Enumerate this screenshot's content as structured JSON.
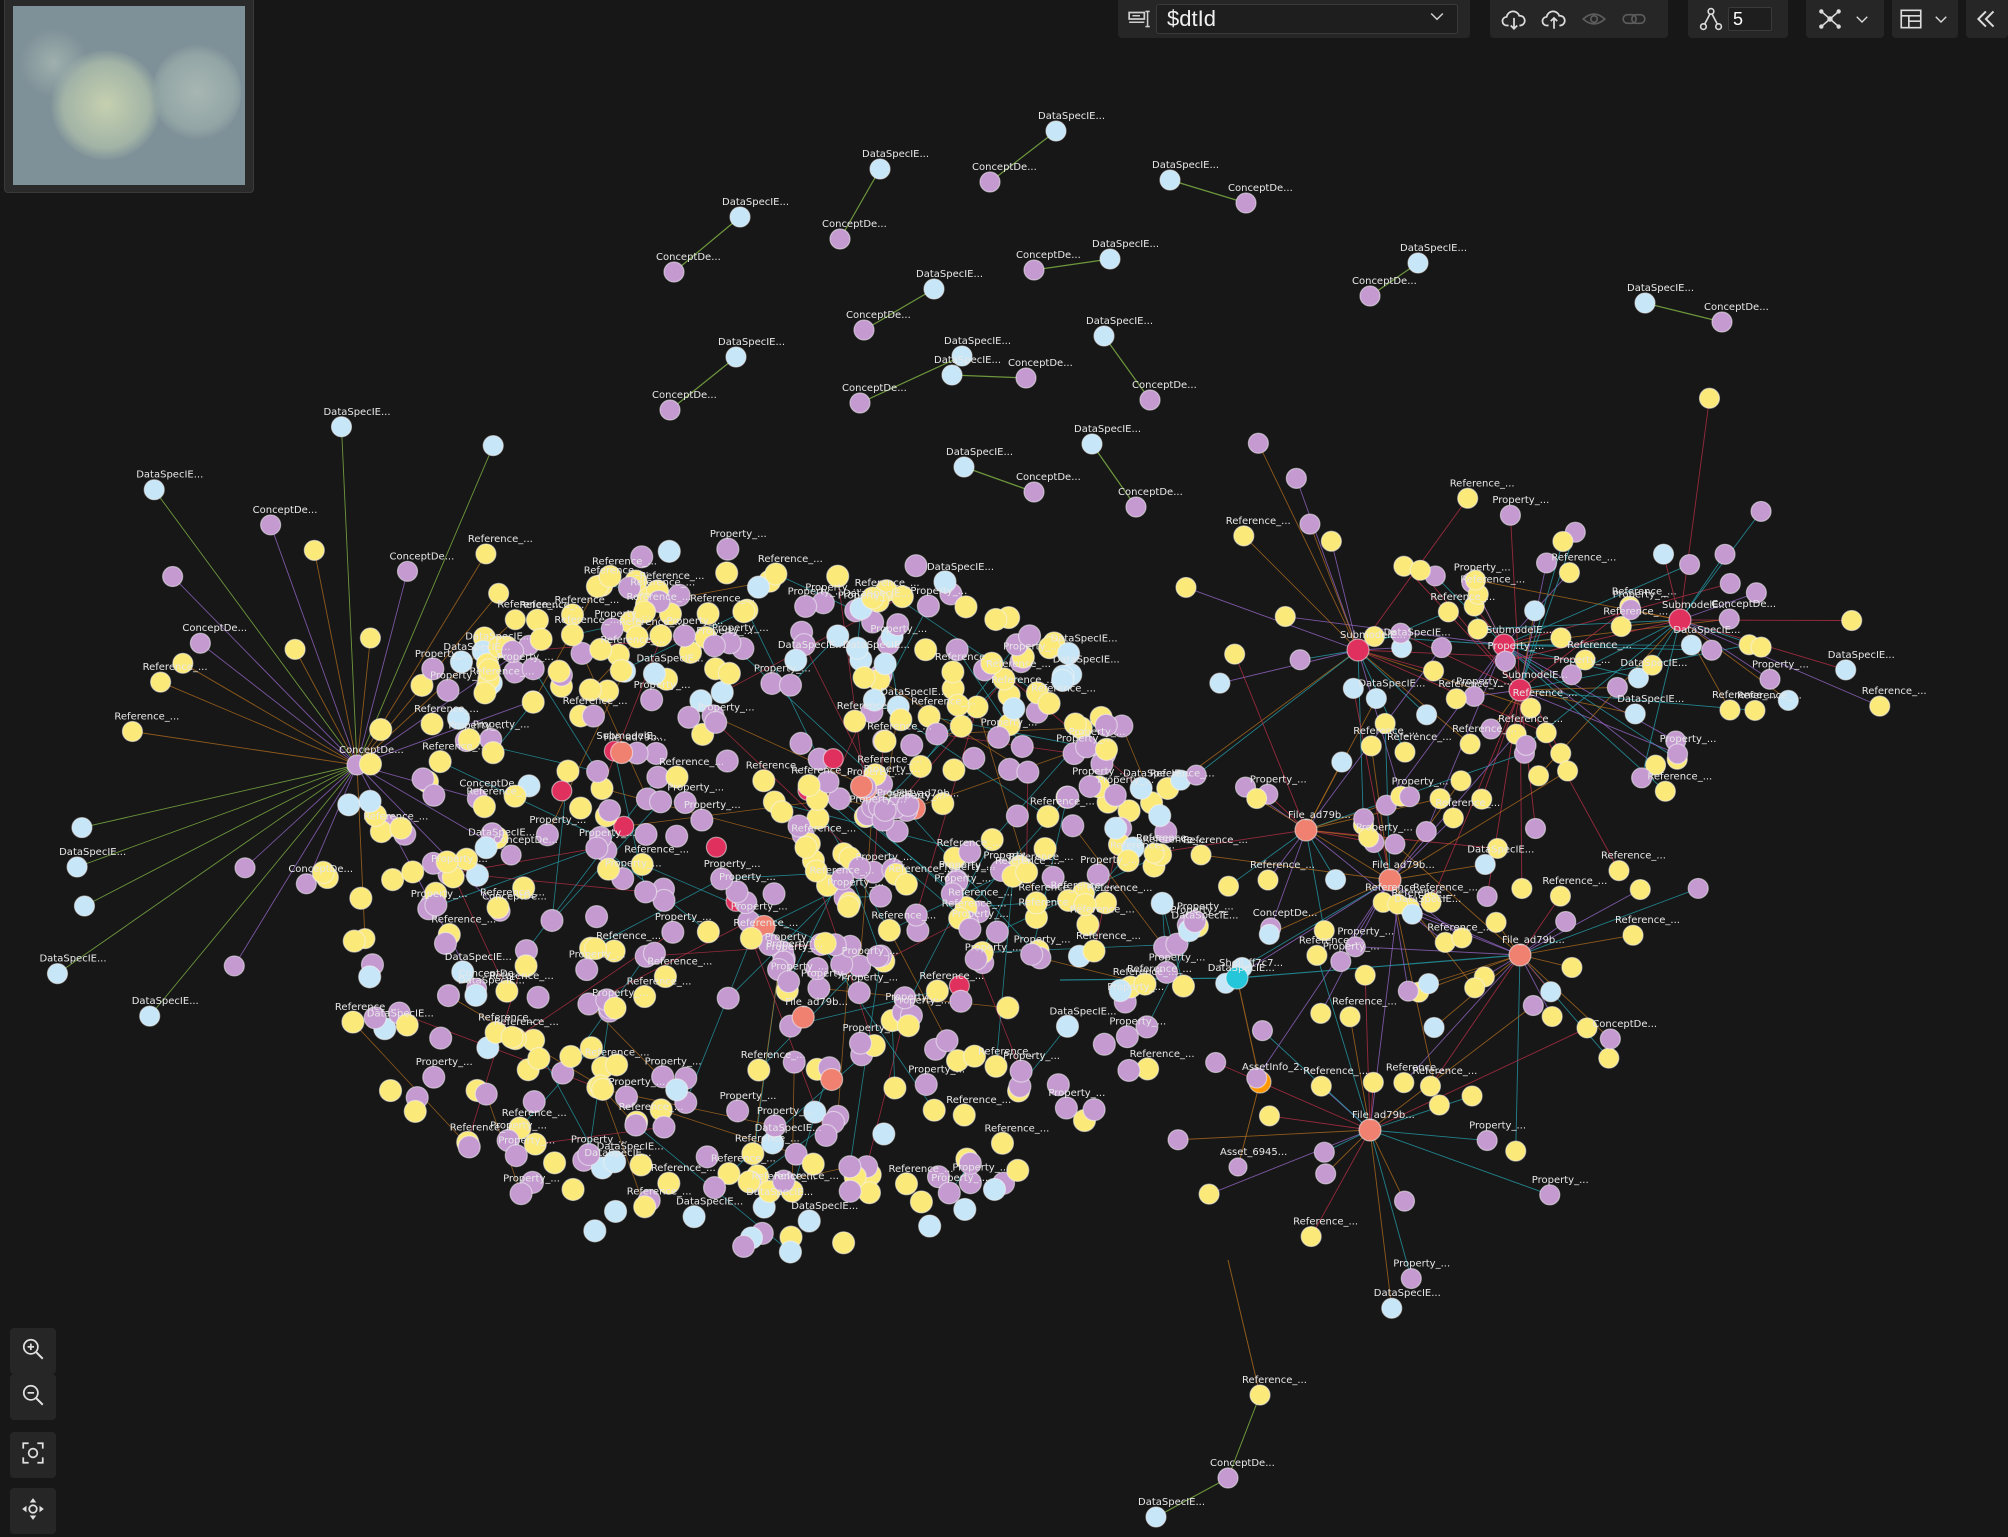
{
  "toolbar": {
    "label_selector_value": "$dtId",
    "expansion_level": "5"
  },
  "graph": {
    "label_texts": [
      "DataSpecIE...",
      "ConceptDe...",
      "Reference_...",
      "Property_...",
      "Submodel_...",
      "File_ad79b...",
      "File_349a3...",
      "File_ba980",
      "Shell_ff7c7...",
      "AssetInfo_2...",
      "Asset_6945...",
      "File_9a6f98...",
      "File_9e61ff...",
      "File_34375...",
      "SubmodelE...",
      "Submodel"
    ]
  },
  "colors": {
    "background": "#171717",
    "data_spec_node": "#c7e6f7",
    "concept_node": "#c49ad0",
    "reference_node": "#fbe97a",
    "property_node": "#c49ad0",
    "submodel_node": "#e0305e",
    "file_node": "#f08070",
    "shell_node": "#26c6da",
    "asset_node": "#ff9800",
    "edge_cyan": "#26a6b3",
    "edge_red": "#c0304a",
    "edge_orange": "#b5701f",
    "edge_green": "#8bc34a",
    "edge_purple": "#9c6bd0"
  },
  "icons": [
    "label-selector-icon",
    "chevron-down-icon",
    "cloud-download-icon",
    "cloud-upload-icon",
    "eye-icon",
    "link-icon",
    "expansion-level-icon",
    "layout-icon",
    "table-view-icon",
    "collapse-panel-icon",
    "zoom-in-icon",
    "zoom-out-icon",
    "fit-view-icon",
    "center-icon"
  ]
}
